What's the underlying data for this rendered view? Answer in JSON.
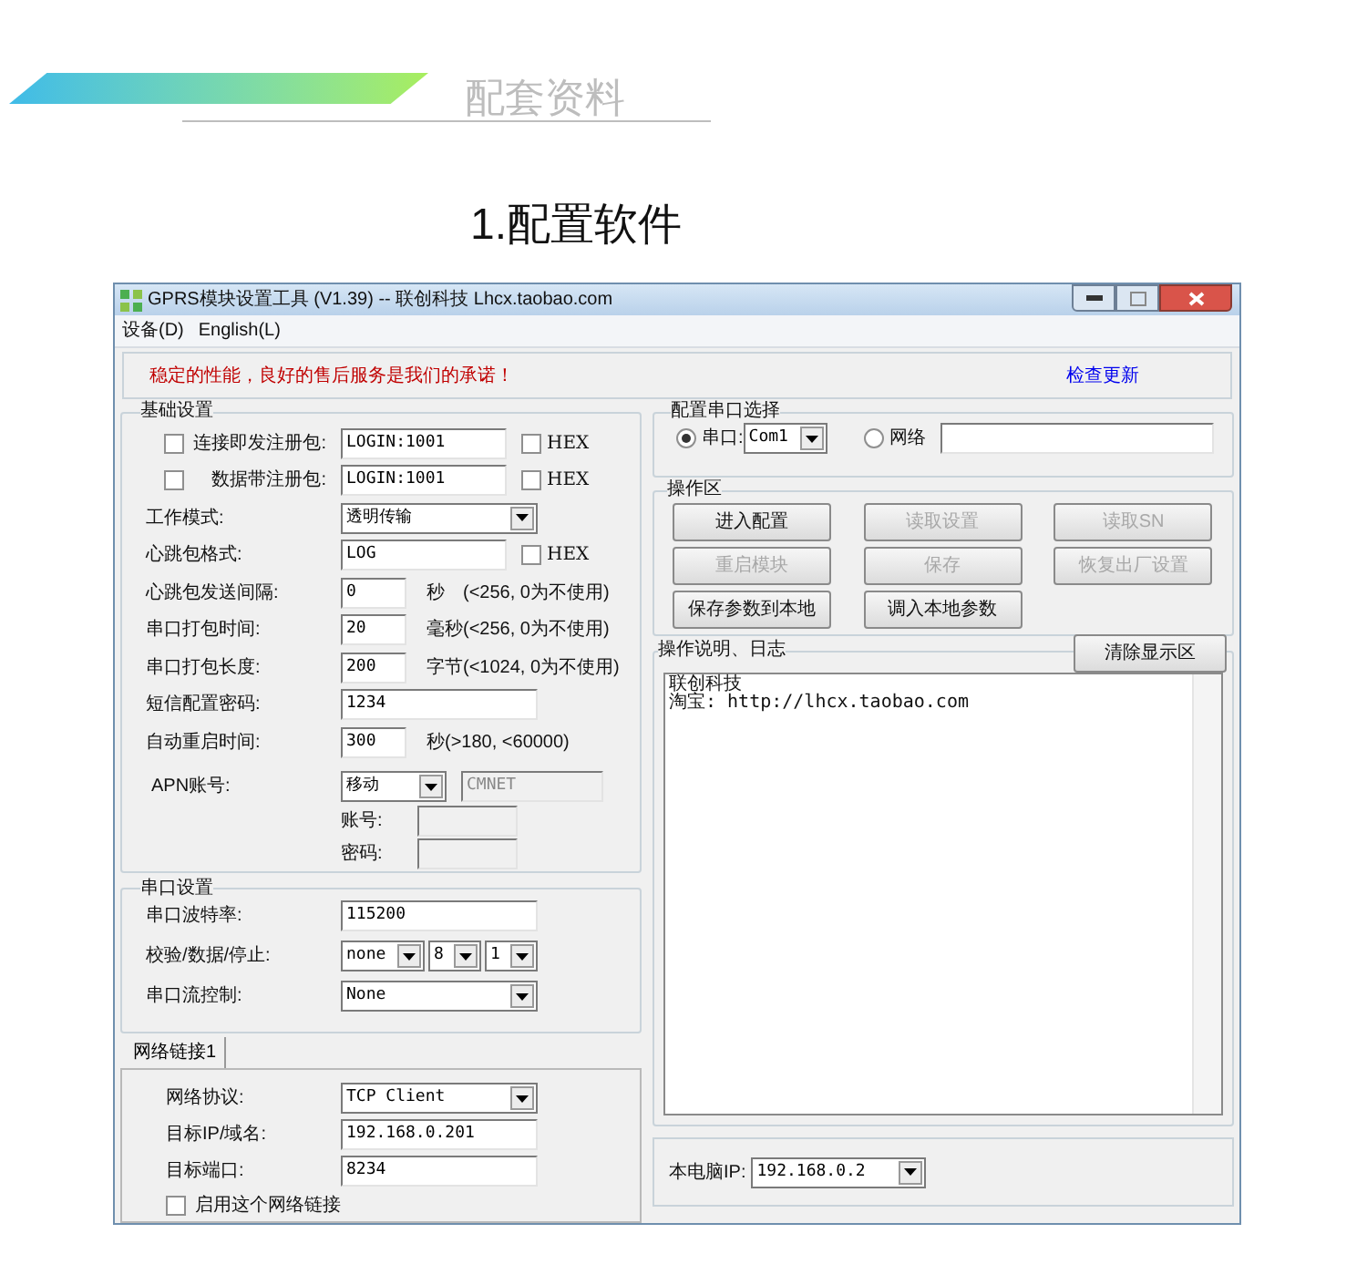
{
  "header": {
    "section_title": "配套资料",
    "subtitle": "1.配置软件"
  },
  "window": {
    "title": "GPRS模块设置工具 (V1.39) -- 联创科技 Lhcx.taobao.com"
  },
  "menu": [
    "设备(D)",
    "English(L)"
  ],
  "banner": {
    "slogan": "稳定的性能，良好的售后服务是我们的承诺！",
    "link": "检查更新"
  },
  "basic_settings": {
    "title": "基础设置",
    "rows": [
      {
        "kind": "register",
        "checked": false,
        "label": "连接即发注册包:",
        "value": "LOGIN:1001",
        "hex_label": "HEX",
        "hex_checked": false
      },
      {
        "kind": "register",
        "checked": false,
        "label": "数据带注册包:",
        "value": "LOGIN:1001",
        "hex_label": "HEX",
        "hex_checked": false
      },
      {
        "kind": "select",
        "label": "工作模式:",
        "value": "透明传输"
      },
      {
        "kind": "text_hex",
        "label": "心跳包格式:",
        "value": "LOG",
        "hex_label": "HEX",
        "hex_checked": false
      },
      {
        "kind": "text_unit",
        "label": "心跳包发送间隔:",
        "value": "0",
        "unit": "秒",
        "note": "(<256, 0为不使用)"
      },
      {
        "kind": "text_unit",
        "label": "串口打包时间:",
        "value": "20",
        "unit": "毫秒(<256, 0为不使用)"
      },
      {
        "kind": "text_unit",
        "label": "串口打包长度:",
        "value": "200",
        "unit": "字节(<1024, 0为不使用)"
      },
      {
        "kind": "text",
        "label": "短信配置密码:",
        "value": "1234"
      },
      {
        "kind": "text_unit",
        "label": "自动重启时间:",
        "value": "300",
        "unit": "秒(>180, <60000)"
      },
      {
        "kind": "apn",
        "label": "APN账号:",
        "value": "移动",
        "apn": "CMNET",
        "account_label": "账号:",
        "password_label": "密码:",
        "disabled": true
      }
    ]
  },
  "serial_settings": {
    "title": "串口设置",
    "baud_label": "串口波特率:",
    "baud": "115200",
    "format_label": "校验/数据/停止:",
    "format": [
      "none",
      "8",
      "1"
    ],
    "flow_label": "串口流控制:",
    "flow": "None"
  },
  "network_tabs": [
    {
      "label": "网络链接1",
      "selected": true
    }
  ],
  "network": {
    "protocol_label": "网络协议:",
    "protocol": "TCP Client",
    "target_label": "目标IP/域名:",
    "target": "192.168.0.201",
    "port_label": "目标端口:",
    "port": "8234",
    "enable": {
      "label": "启用这个网络链接",
      "checked": false
    }
  },
  "port_select": {
    "title": "配置串口选择",
    "options": [
      {
        "kind": "select",
        "label": "串口:",
        "value": "Com1",
        "selected": true
      },
      {
        "kind": "text",
        "label": "网络",
        "selected": false
      }
    ]
  },
  "operations": {
    "title": "操作区",
    "buttons": [
      {
        "label": "进入配置",
        "disabled": false
      },
      {
        "label": "读取设置",
        "disabled": true
      },
      {
        "label": "读取SN",
        "disabled": true
      },
      {
        "label": "重启模块",
        "disabled": true
      },
      {
        "label": "保存",
        "disabled": true
      },
      {
        "label": "恢复出厂设置",
        "disabled": true
      },
      {
        "label": "保存参数到本地",
        "disabled": false
      },
      {
        "label": "调入本地参数",
        "disabled": false
      }
    ]
  },
  "log": {
    "title": "操作说明、日志",
    "clear_button": "清除显示区",
    "lines": [
      "联创科技",
      "淘宝: http://lhcx.taobao.com"
    ]
  },
  "local_ip": {
    "label": "本电脑IP:",
    "value": "192.168.0.2"
  }
}
